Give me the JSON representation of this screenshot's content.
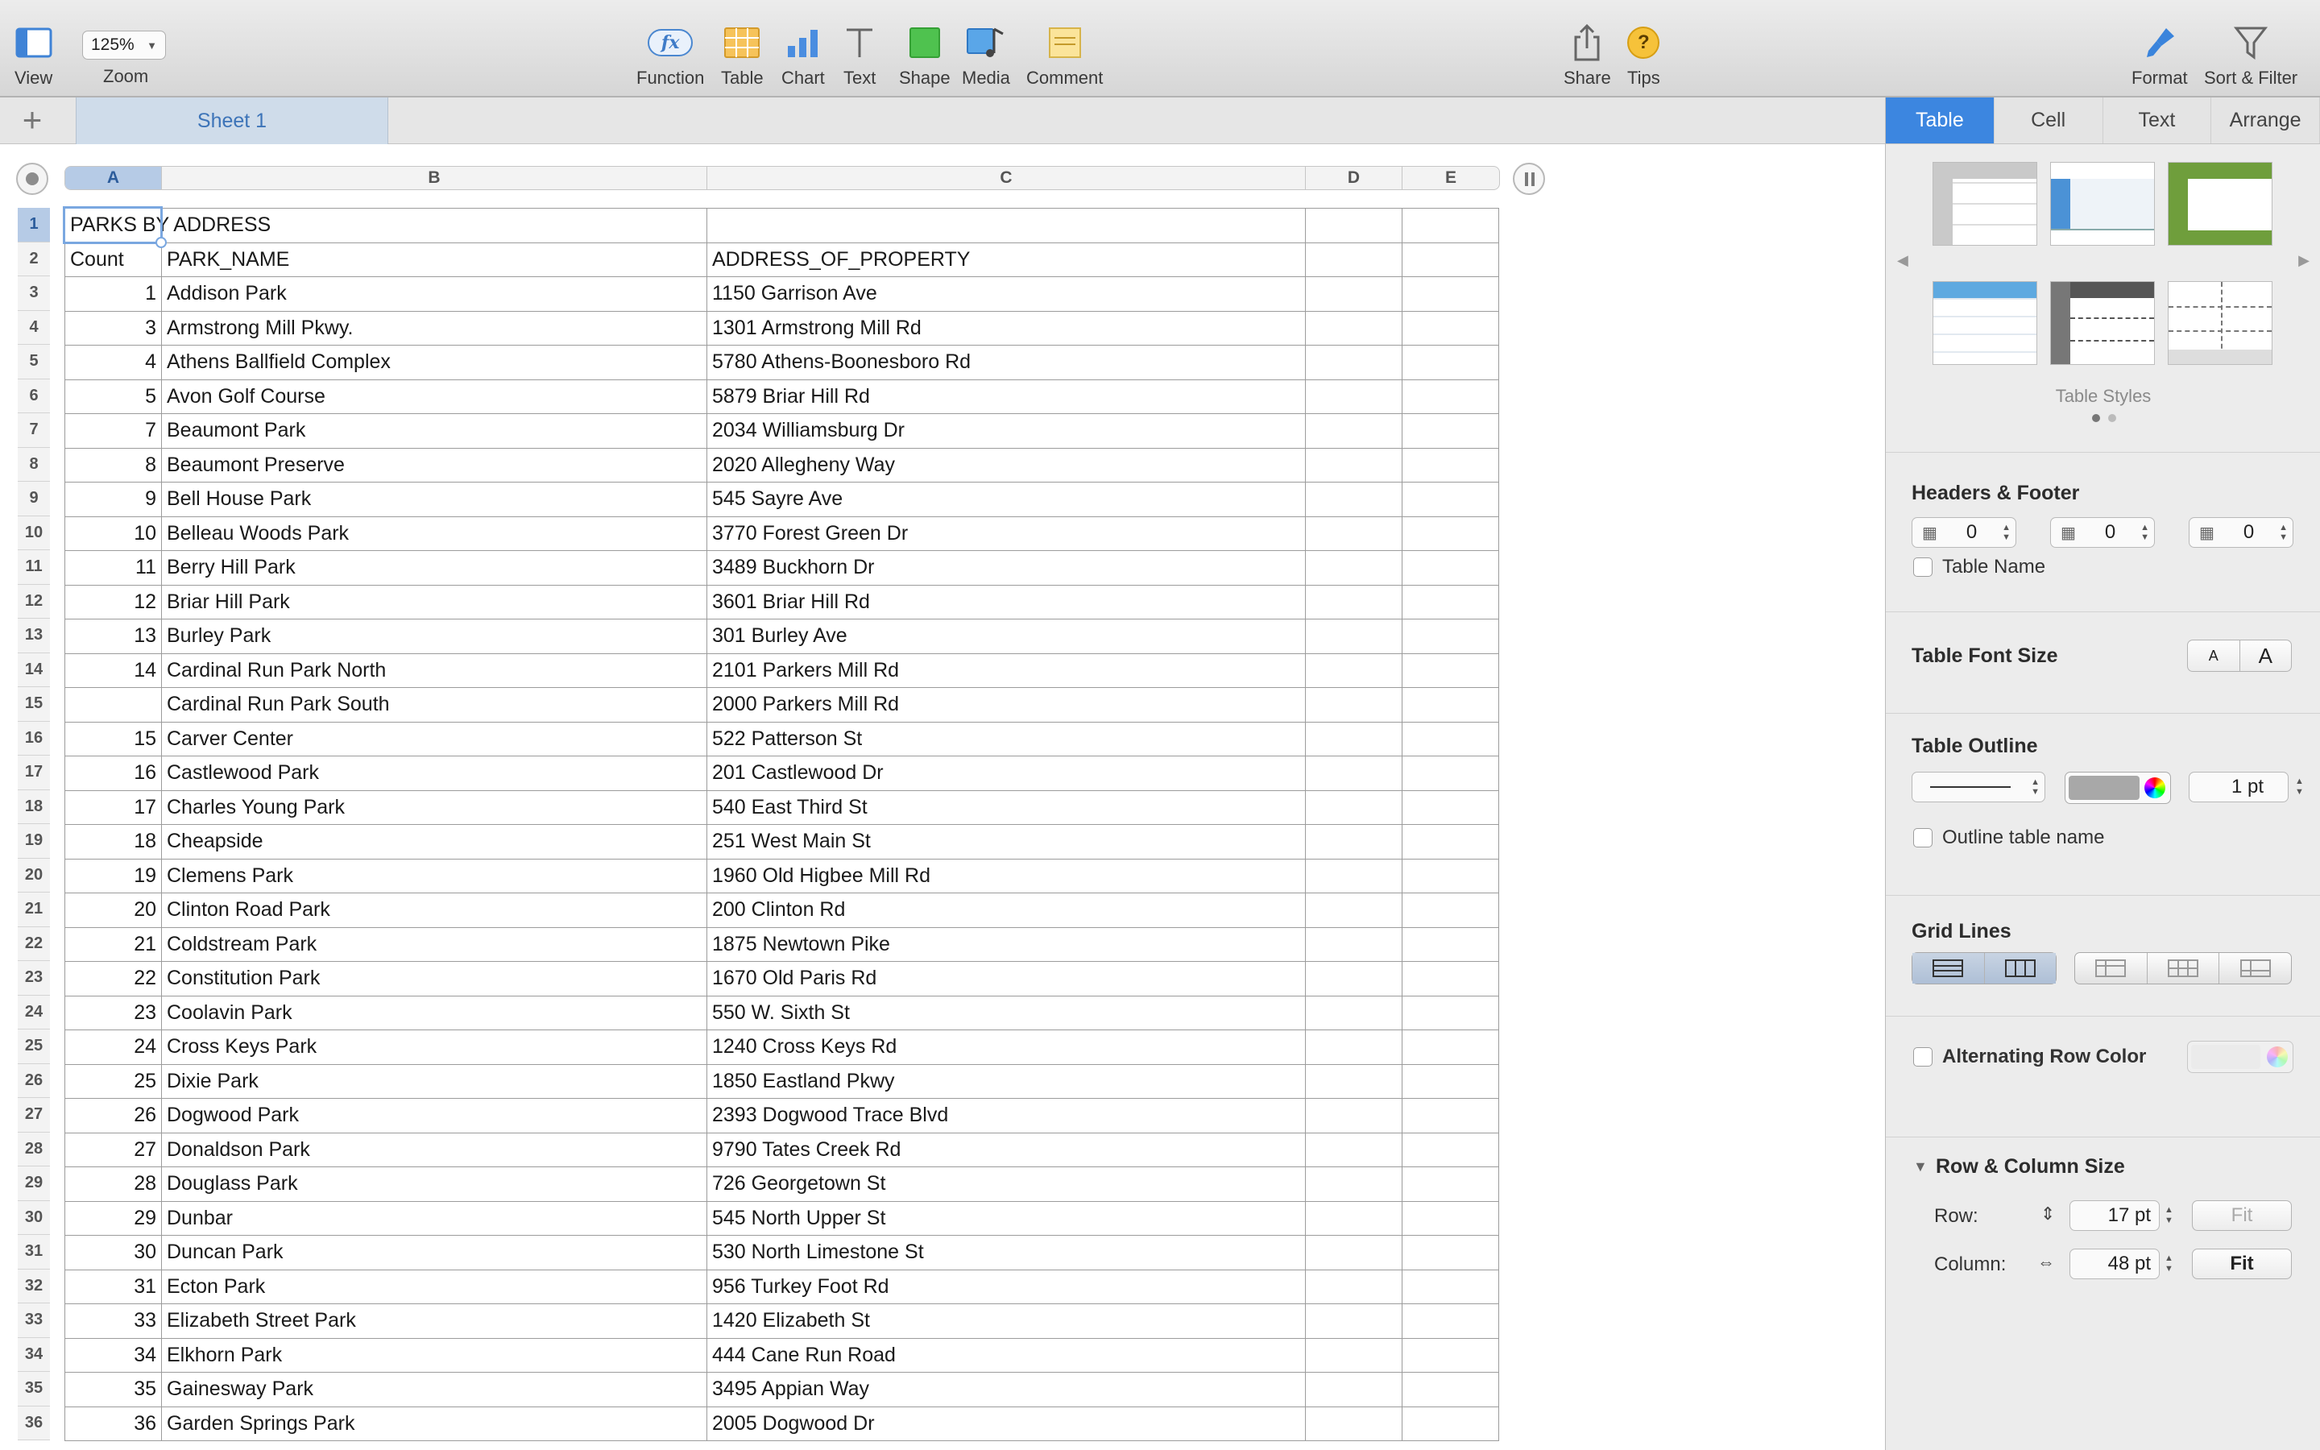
{
  "toolbar": {
    "view_label": "View",
    "zoom_value": "125%",
    "zoom_label": "Zoom",
    "function_label": "Function",
    "table_label": "Table",
    "chart_label": "Chart",
    "text_label": "Text",
    "shape_label": "Shape",
    "media_label": "Media",
    "comment_label": "Comment",
    "share_label": "Share",
    "tips_label": "Tips",
    "format_label": "Format",
    "sort_filter_label": "Sort & Filter",
    "function_icon_text": "fx",
    "tips_icon_text": "?"
  },
  "sheet_tabs": [
    "Sheet 1"
  ],
  "add_sheet_glyph": "+",
  "columns": [
    "A",
    "B",
    "C",
    "D",
    "E"
  ],
  "spreadsheet": {
    "title": "PARKS BY ADDRESS",
    "headers": [
      "Count",
      "PARK_NAME",
      "ADDRESS_OF_PROPERTY"
    ],
    "rows": [
      [
        "1",
        "Addison Park",
        "1150 Garrison Ave"
      ],
      [
        "3",
        "Armstrong Mill Pkwy.",
        "1301 Armstrong Mill Rd"
      ],
      [
        "4",
        "Athens Ballfield Complex",
        "5780 Athens-Boonesboro Rd"
      ],
      [
        "5",
        "Avon Golf Course",
        "5879 Briar Hill Rd"
      ],
      [
        "7",
        "Beaumont Park",
        "2034 Williamsburg Dr"
      ],
      [
        "8",
        "Beaumont Preserve",
        "2020 Allegheny Way"
      ],
      [
        "9",
        "Bell House Park",
        "545 Sayre Ave"
      ],
      [
        "10",
        "Belleau Woods Park",
        "3770 Forest Green Dr"
      ],
      [
        "11",
        "Berry Hill Park",
        "3489 Buckhorn Dr"
      ],
      [
        "12",
        "Briar Hill Park",
        "3601 Briar Hill Rd"
      ],
      [
        "13",
        "Burley Park",
        "301 Burley Ave"
      ],
      [
        "14",
        "Cardinal Run Park North",
        "2101 Parkers Mill Rd"
      ],
      [
        "",
        "Cardinal Run Park South",
        "2000 Parkers Mill Rd"
      ],
      [
        "15",
        "Carver Center",
        "522 Patterson St"
      ],
      [
        "16",
        "Castlewood Park",
        "201 Castlewood Dr"
      ],
      [
        "17",
        "Charles Young Park",
        "540 East Third St"
      ],
      [
        "18",
        "Cheapside",
        "251 West Main St"
      ],
      [
        "19",
        "Clemens Park",
        "1960 Old Higbee Mill Rd"
      ],
      [
        "20",
        "Clinton Road Park",
        "200 Clinton Rd"
      ],
      [
        "21",
        "Coldstream Park",
        "1875 Newtown Pike"
      ],
      [
        "22",
        "Constitution Park",
        "1670 Old Paris Rd"
      ],
      [
        "23",
        "Coolavin Park",
        "550 W. Sixth St"
      ],
      [
        "24",
        "Cross Keys Park",
        "1240 Cross Keys Rd"
      ],
      [
        "25",
        "Dixie Park",
        "1850 Eastland Pkwy"
      ],
      [
        "26",
        "Dogwood Park",
        "2393 Dogwood Trace Blvd"
      ],
      [
        "27",
        "Donaldson Park",
        "9790 Tates Creek Rd"
      ],
      [
        "28",
        "Douglass Park",
        "726 Georgetown St"
      ],
      [
        "29",
        "Dunbar",
        "545 North Upper St"
      ],
      [
        "30",
        "Duncan Park",
        "530 North Limestone St"
      ],
      [
        "31",
        "Ecton Park",
        "956 Turkey Foot Rd"
      ],
      [
        "33",
        "Elizabeth Street Park",
        "1420 Elizabeth St"
      ],
      [
        "34",
        "Elkhorn Park",
        "444 Cane Run Road"
      ],
      [
        "35",
        "Gainesway Park",
        "3495 Appian Way"
      ],
      [
        "36",
        "Garden Springs Park",
        "2005 Dogwood Dr"
      ]
    ]
  },
  "inspector": {
    "tabs": [
      "Table",
      "Cell",
      "Text",
      "Arrange"
    ],
    "active_tab": "Table",
    "table_styles_label": "Table Styles",
    "headers_footer_title": "Headers & Footer",
    "header_rows_value": "0",
    "header_cols_value": "0",
    "footer_rows_value": "0",
    "table_name_label": "Table Name",
    "table_font_size_title": "Table Font Size",
    "font_smaller_glyph": "A",
    "font_larger_glyph": "A",
    "table_outline_title": "Table Outline",
    "outline_width_value": "1 pt",
    "outline_table_name_label": "Outline table name",
    "grid_lines_title": "Grid Lines",
    "alternating_row_color_label": "Alternating Row Color",
    "row_col_size_title": "Row & Column Size",
    "row_label": "Row:",
    "row_value": "17 pt",
    "row_fit_label": "Fit",
    "column_label": "Column:",
    "column_value": "48 pt",
    "column_fit_label": "Fit"
  },
  "colors": {
    "accent_blue": "#3c86e0",
    "selection_blue": "#b6cbe6",
    "sheet_tab_text": "#3d74b8"
  }
}
